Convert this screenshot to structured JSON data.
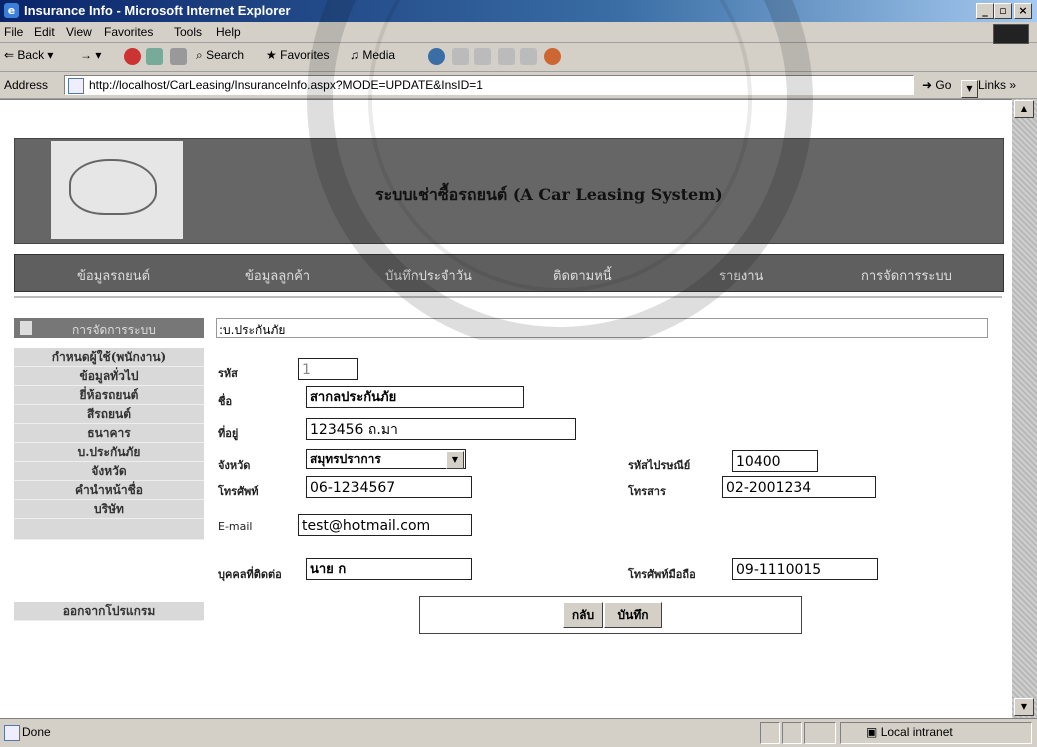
{
  "window": {
    "title": "Insurance Info - Microsoft Internet Explorer",
    "buttons": [
      "_",
      "▫",
      "×"
    ]
  },
  "menu": [
    "File",
    "Edit",
    "View",
    "Favorites",
    "Tools",
    "Help"
  ],
  "toolbar": {
    "back": "Back",
    "search": "Search",
    "favorites": "Favorites",
    "media": "Media"
  },
  "address": {
    "label": "Address",
    "url": "http://localhost/CarLeasing/InsuranceInfo.aspx?MODE=UPDATE&InsID=1",
    "go": "Go",
    "links": "Links »"
  },
  "banner": {
    "title": "ระบบเช่าซื้อรถยนต์ (A Car Leasing System)"
  },
  "nav": [
    "ข้อมูลรถยนต์",
    "ข้อมูลลูกค้า",
    "บันทึกประจำวัน",
    "ติดตามหนี้",
    "รายงาน",
    "การจัดการระบบ"
  ],
  "sidebar": {
    "heading": "การจัดการระบบ",
    "items": [
      "กำหนดผู้ใช้(พนักงาน)",
      "ข้อมูลทั่วไป",
      "ยี่ห้อรถยนต์",
      "สีรถยนต์",
      "ธนาคาร",
      "บ.ประกันภัย",
      "จังหวัด",
      "คำนำหน้าชื่อ",
      "บริษัท",
      "",
      "ออกจากโปรแกรม"
    ]
  },
  "form": {
    "title": ":บ.ประกันภัย",
    "code_label": "รหัส",
    "code_value": "1",
    "name_label": "ชื่อ",
    "name_value": "สากลประกันภัย",
    "address_label": "ที่อยู่",
    "address_value": "123456 ถ.มา",
    "province_label": "จังหวัด",
    "province_value": "สมุทรปราการ",
    "zip_label": "รหัสไปรษณีย์",
    "zip_value": "10400",
    "phone_label": "โทรศัพท์",
    "phone_value": "06-1234567",
    "fax_label": "โทรสาร",
    "fax_value": "02-2001234",
    "email_label": "E-mail",
    "email_value": "test@hotmail.com",
    "contact_label": "บุคคลที่ติดต่อ",
    "contact_value": "นาย ก",
    "mobile_label": "โทรศัพท์มือถือ",
    "mobile_value": "09-1110015",
    "back_button": "กลับ",
    "save_button": "บันทึก"
  },
  "status": {
    "text": "Done",
    "zone": "Local intranet"
  }
}
